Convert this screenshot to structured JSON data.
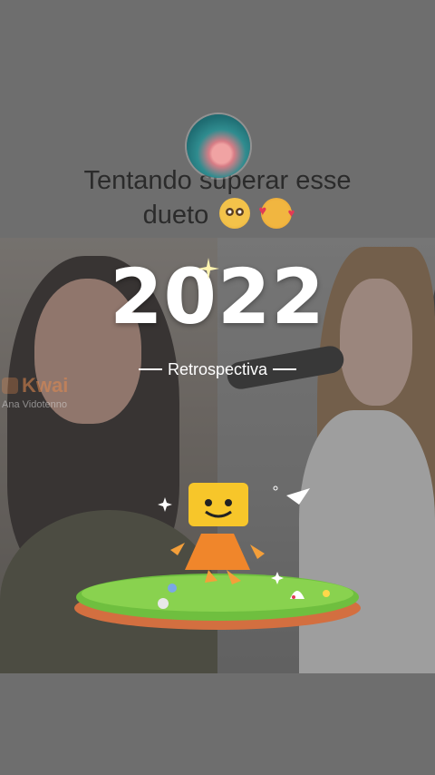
{
  "post": {
    "caption_line1": "Tentando superar esse",
    "caption_line2": "dueto",
    "caption_emojis": [
      "flushed-face",
      "smiling-face-with-hearts"
    ]
  },
  "watermark": {
    "brand": "Kwai",
    "username": "Ana Vidotenno"
  },
  "overlay": {
    "year": "2022",
    "subtitle": "Retrospectiva"
  },
  "colors": {
    "background": "#6e6e6e",
    "caption_text": "#2b2b2b",
    "overlay_text": "#ffffff",
    "brand_orange": "#e38a4f"
  }
}
